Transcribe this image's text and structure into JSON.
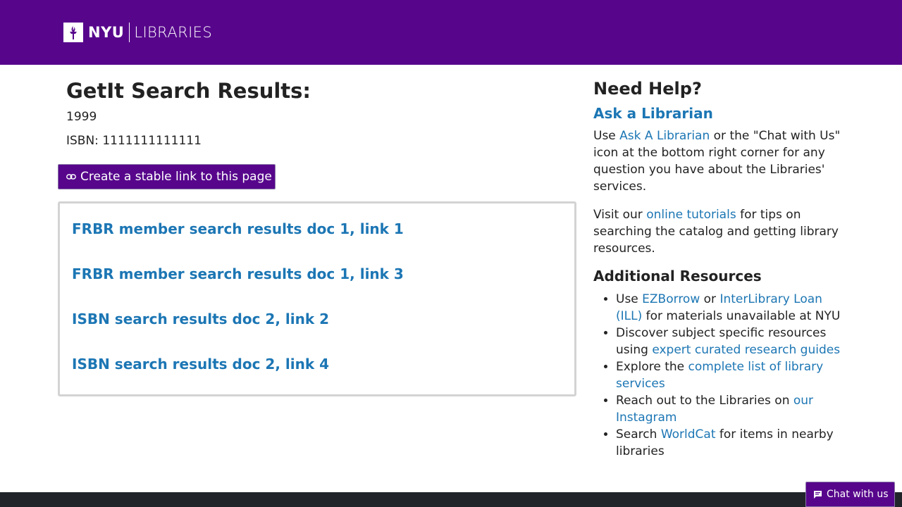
{
  "header": {
    "logo_nyu": "NYU",
    "logo_libraries": "LIBRARIES",
    "background_color": "#57068c"
  },
  "main": {
    "title": "GetIt Search Results:",
    "year": "1999",
    "isbn": "ISBN: 1111111111111",
    "stable_link_button": "Create a stable link to this page",
    "results": [
      "FRBR member search results doc 1, link 1",
      "FRBR member search results doc 1, link 3",
      "ISBN search results doc 2, link 2",
      "ISBN search results doc 2, link 4"
    ]
  },
  "sidebar": {
    "heading": "Need Help?",
    "ask_link": "Ask a Librarian",
    "para1": {
      "prefix": "Use ",
      "link": "Ask A Librarian",
      "suffix": " or the \"Chat with Us\" icon at the bottom right corner for any question you have about the Libraries' services."
    },
    "para2": {
      "prefix": "Visit our ",
      "link": "online tutorials",
      "suffix": " for tips on searching the catalog and getting library resources."
    },
    "additional_heading": "Additional Resources",
    "resources": [
      {
        "prefix": "Use ",
        "link1": "EZBorrow",
        "mid": " or ",
        "link2": "InterLibrary Loan (ILL)",
        "suffix": " for materials unavailable at NYU"
      },
      {
        "prefix": "Discover subject specific resources using ",
        "link1": "expert curated research guides",
        "suffix": ""
      },
      {
        "prefix": "Explore the ",
        "link1": "complete list of library services",
        "suffix": ""
      },
      {
        "prefix": "Reach out to the Libraries on ",
        "link1": "our Instagram",
        "suffix": ""
      },
      {
        "prefix": "Search ",
        "link1": "WorldCat",
        "suffix": " for items in nearby libraries"
      }
    ]
  },
  "chat": {
    "label": "Chat with us"
  },
  "colors": {
    "brand_purple": "#57068c",
    "link_blue": "#1c76b4",
    "footer_dark": "#212529"
  },
  "icons": {
    "logo": "nyu-torch-icon",
    "stable_link": "link-icon",
    "chat": "chat-icon"
  }
}
